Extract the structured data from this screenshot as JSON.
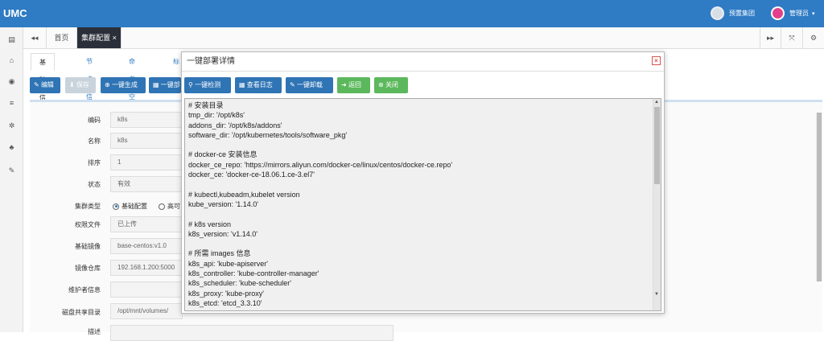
{
  "header": {
    "logo": "UMC",
    "user1": "预置集团",
    "user2": "管理员",
    "caret": "▾"
  },
  "tabs": {
    "home": "首页",
    "current": "集群配置",
    "close": "×",
    "prev": "◂◂",
    "next": "▸▸",
    "expand": "⤧",
    "gear": "⚙"
  },
  "subtabs": [
    "基础信息",
    "节点信息",
    "命名空间",
    "标"
  ],
  "toolbar": {
    "edit": "编辑",
    "save": "保存",
    "generate": "一键生成",
    "deploy": "一键部"
  },
  "form": {
    "labels": [
      "编码",
      "名称",
      "排序",
      "状态",
      "集群类型",
      "权限文件",
      "基础镜像",
      "镜像仓库",
      "维护者信息",
      "磁盘共享目录",
      "描述"
    ],
    "values": [
      "k8s",
      "k8s",
      "1",
      "有效",
      "",
      "已上传",
      "base-centos:v1.0",
      "192.168.1.200:5000",
      "",
      "/opt/mnt/volumes/"
    ],
    "radio1": "基础配置",
    "radio2": "高可"
  },
  "modal": {
    "title": "一键部署详情",
    "close": "×",
    "buttons": {
      "check": "一键检测",
      "log": "查看日志",
      "uninstall": "一键卸载",
      "back": "返回",
      "close": "关闭"
    },
    "code": "# 安装目录\ntmp_dir: '/opt/k8s'\naddons_dir: '/opt/k8s/addons'\nsoftware_dir: '/opt/kubernetes/tools/software_pkg'\n\n# docker-ce 安装信息\ndocker_ce_repo: 'https://mirrors.aliyun.com/docker-ce/linux/centos/docker-ce.repo'\ndocker_ce: 'docker-ce-18.06.1.ce-3.el7'\n\n# kubectl,kubeadm,kubelet version\nkube_version: '1.14.0'\n\n# k8s version\nk8s_version: 'v1.14.0'\n\n# 所需 images 信息\nk8s_api: 'kube-apiserver'\nk8s_controller: 'kube-controller-manager'\nk8s_scheduler: 'kube-scheduler'\nk8s_proxy: 'kube-proxy'\nk8s_etcd: 'etcd_3.3.10'"
  },
  "colors": {
    "topbar": "#2f7bc4",
    "primary": "#2f74b5",
    "success": "#5cb85c",
    "danger": "#d9534f"
  }
}
